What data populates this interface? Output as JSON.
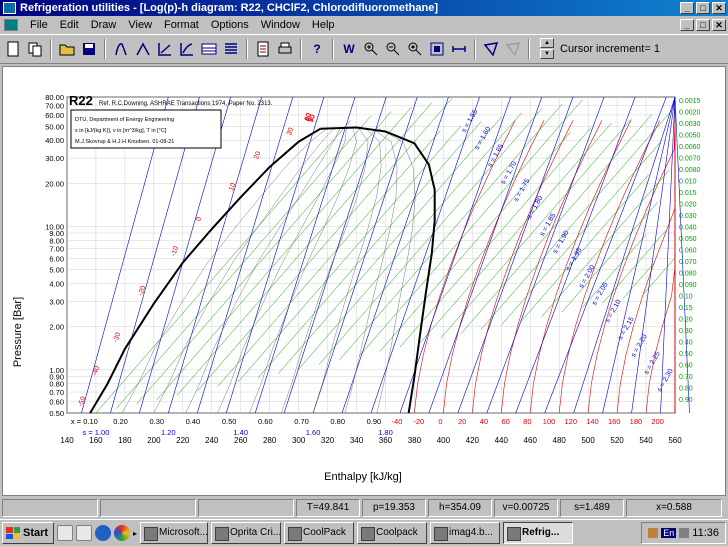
{
  "window": {
    "title": "Refrigeration utilities - [Log(p)-h diagram: R22, CHClF2, Chlorodifluoromethane]",
    "controls": [
      "_",
      "□",
      "✕"
    ]
  },
  "menubar": {
    "items": [
      "File",
      "Edit",
      "Draw",
      "View",
      "Format",
      "Options",
      "Window",
      "Help"
    ]
  },
  "toolbar": {
    "cursor_label": "Cursor increment= 1",
    "tools": [
      "new-file",
      "copy",
      "open-folder",
      "save",
      "log-ph",
      "ts-diagram",
      "hs-diagram",
      "chart",
      "sat-table",
      "list",
      "zoom-window",
      "zoom-in",
      "zoom-out",
      "zoom-reset",
      "zoom-fit",
      "width",
      "cycle",
      "eraser",
      "help",
      "document",
      "print"
    ]
  },
  "chart_data": {
    "type": "line",
    "title": "R22",
    "reference": "Ref. R.C.Downing, ASHRAE Transactions 1974, Paper No. 2313.",
    "info_box": [
      "DTU, Department of Energy Engineering",
      "s in [kJ/(kg K)], v in [m^3/kg], T in [°C]",
      "M.J.Skovrup & H.J.H Knudsen. 01-08-21"
    ],
    "xlabel": "Enthalpy [kJ/kg]",
    "ylabel": "Pressure [Bar]",
    "x_ticks": [
      "140",
      "160",
      "180",
      "200",
      "220",
      "240",
      "260",
      "280",
      "300",
      "320",
      "340",
      "360",
      "380",
      "400",
      "420",
      "440",
      "460",
      "480",
      "500",
      "520",
      "540",
      "560"
    ],
    "y_ticks": [
      "0.50",
      "0.60",
      "0.70",
      "0.80",
      "0.90",
      "1.00",
      "2.00",
      "3.00",
      "4.00",
      "5.00",
      "6.00",
      "7.00",
      "8.00",
      "9.00",
      "10.00",
      "20.00",
      "30.00",
      "40.00",
      "50.00",
      "60.00",
      "70.00",
      "80.00"
    ],
    "xlim": [
      140,
      560
    ],
    "ylim": [
      0.5,
      80
    ],
    "y_scale": "log",
    "quality_labels": [
      "x = 0.10",
      "0.20",
      "0.30",
      "0.40",
      "0.50",
      "0.60",
      "0.70",
      "0.80",
      "0.90"
    ],
    "entropy_labels": [
      "s = 1.00",
      "1.20",
      "1.40",
      "1.60",
      "1.80"
    ],
    "temp_labels_red": [
      "-40",
      "-20",
      "0",
      "20",
      "40",
      "60",
      "80",
      "100",
      "120",
      "140",
      "160",
      "180",
      "200"
    ],
    "sat_temps": [
      "-50",
      "-40",
      "-30",
      "-20",
      "-10",
      "0",
      "10",
      "20",
      "30",
      "40",
      "50",
      "60",
      "70",
      "80",
      "90"
    ],
    "vol_labels": [
      "0.0015",
      "0.0020",
      "0.0030",
      "0.0050",
      "0.0060",
      "0.0070",
      "0.0080",
      "0.010",
      "0.015",
      "0.020",
      "0.030",
      "0.040",
      "0.050",
      "0.060",
      "0.070",
      "0.080",
      "0.090",
      "0.10",
      "0.15",
      "0.20",
      "0.30",
      "0.40",
      "0.50",
      "0.60",
      "0.70",
      "0.80",
      "0.90"
    ],
    "entropy_right": [
      "s = 1.55",
      "s = 1.60",
      "s = 1.65",
      "s = 1.70",
      "s = 1.75",
      "s = 1.80",
      "s = 1.85",
      "s = 1.90",
      "s = 1.95",
      "s = 2.00",
      "s = 2.05",
      "s = 2.10",
      "s = 2.15",
      "s = 2.20",
      "s = 2.25",
      "s = 2.30"
    ],
    "grid": true,
    "series_colors": {
      "saturation": "#000000",
      "isotherm": "#e00000",
      "isochore": "#00a000",
      "isentrope": "#0000e0",
      "quality": "#000000"
    }
  },
  "status": {
    "fields": [
      "",
      "",
      "",
      "T=49.841",
      "p=19.353",
      "h=354.09",
      "v=0.00725",
      "s=1.489",
      "x=0.588"
    ]
  },
  "taskbar": {
    "start": "Start",
    "tasks": [
      "Microsoft...",
      "Oprita Cri...",
      "CoolPack",
      "Coolpack",
      "imag4.b...",
      "Refrig..."
    ],
    "active_task": "Refrig...",
    "lang": "En",
    "time": "11:36"
  }
}
